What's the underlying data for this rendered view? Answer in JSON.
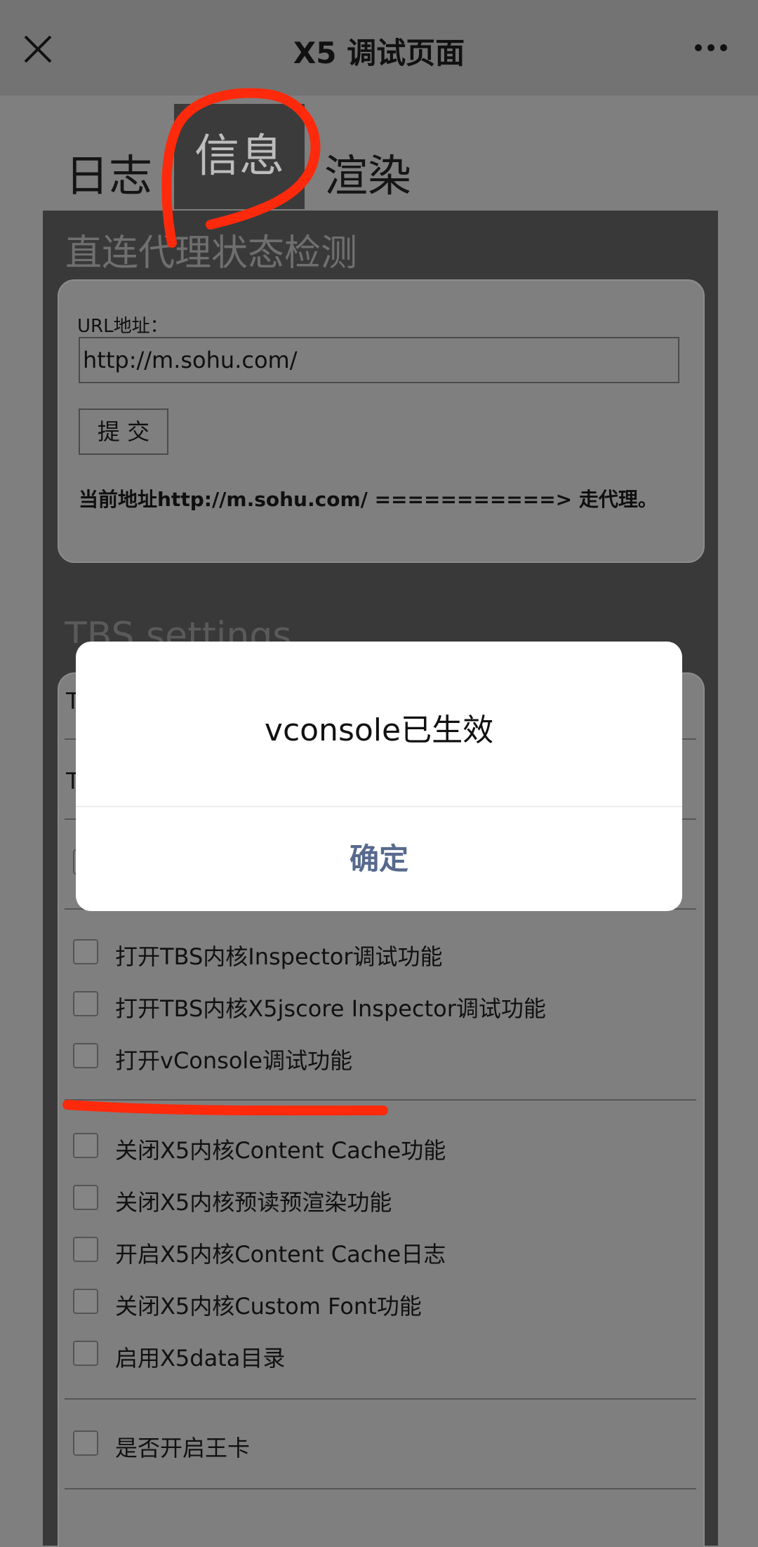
{
  "topbar": {
    "title": "X5 调试页面"
  },
  "tabs": [
    "日志",
    "信息",
    "渲染"
  ],
  "proxy_section": {
    "title": "直连代理状态检测",
    "url_label": "URL地址：",
    "url_value": "http://m.sohu.com/",
    "submit_label": "提 交",
    "status": "当前地址http://m.sohu.com/ ===========> 走代理。"
  },
  "tbs_section": {
    "title": "TBS settings",
    "row1_prefix": "T",
    "row2_prefix": "T",
    "group1": [
      {
        "label": "打开TBS内核Inspector调试功能",
        "checked": false
      },
      {
        "label": "打开TBS内核X5jscore Inspector调试功能",
        "checked": false
      },
      {
        "label": "打开vConsole调试功能",
        "checked": false
      }
    ],
    "group2": [
      {
        "label": "关闭X5内核Content Cache功能",
        "checked": false
      },
      {
        "label": "关闭X5内核预读预渲染功能",
        "checked": false
      },
      {
        "label": "开启X5内核Content Cache日志",
        "checked": false
      },
      {
        "label": "关闭X5内核Custom Font功能",
        "checked": false
      },
      {
        "label": "启用X5data目录",
        "checked": false
      }
    ],
    "group3": [
      {
        "label": "是否开启王卡",
        "checked": false
      }
    ]
  },
  "dialog": {
    "message": "vconsole已生效",
    "confirm_label": "确定"
  },
  "colors": {
    "annotation": "#ff2a0c",
    "dialog_button": "#57698d"
  }
}
